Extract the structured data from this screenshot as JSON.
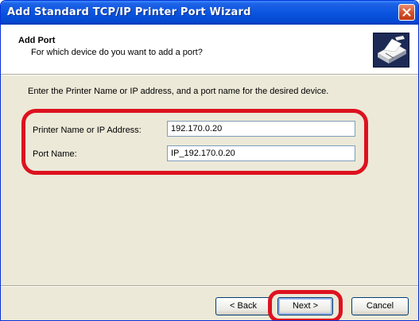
{
  "window": {
    "title": "Add Standard TCP/IP Printer Port Wizard",
    "close_icon": "close-icon"
  },
  "header": {
    "title": "Add Port",
    "subtitle": "For which device do you want to add a port?",
    "icon": "printer-port-icon"
  },
  "main": {
    "instruction": "Enter the Printer Name or IP address, and a port name for the desired device.",
    "fields": [
      {
        "label": "Printer Name or IP Address:",
        "value": "192.170.0.20"
      },
      {
        "label": "Port Name:",
        "value": "IP_192.170.0.20"
      }
    ]
  },
  "footer": {
    "back_label": "< Back",
    "next_label": "Next >",
    "cancel_label": "Cancel"
  },
  "colors": {
    "titlebar": "#0A55E0",
    "dialog_bg": "#ECE9D8",
    "highlight": "#DD1220"
  }
}
